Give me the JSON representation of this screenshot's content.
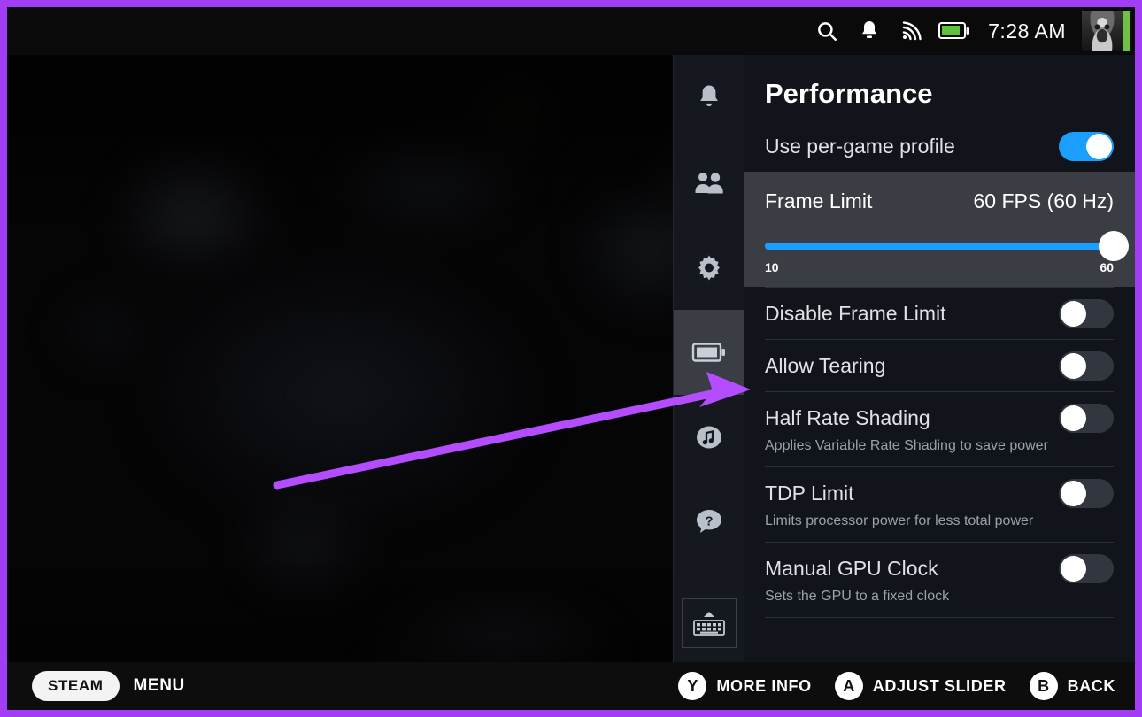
{
  "theme": {
    "border_accent": "#a23cf5",
    "panel_bg": "#11141b",
    "toggle_on": "#1a9fff",
    "slider_fill": "#1a9fff",
    "selected_row_bg": "#3a3d44",
    "status_online": "#6fc045"
  },
  "statusbar": {
    "icons": [
      "search-icon",
      "notifications-bell-icon",
      "wifi-icon",
      "battery-icon"
    ],
    "time": "7:28 AM",
    "avatar_name": "user-avatar"
  },
  "sidebar": {
    "items": [
      {
        "name": "notifications",
        "icon": "bell-icon",
        "active": false
      },
      {
        "name": "friends",
        "icon": "friends-icon",
        "active": false
      },
      {
        "name": "settings",
        "icon": "gear-icon",
        "active": false
      },
      {
        "name": "performance",
        "icon": "battery-icon",
        "active": true
      },
      {
        "name": "music",
        "icon": "music-note-icon",
        "active": false
      },
      {
        "name": "help",
        "icon": "question-mark-icon",
        "active": false
      }
    ],
    "keyboard_button": {
      "name": "on-screen-keyboard",
      "icon": "keyboard-icon"
    }
  },
  "panel": {
    "title": "Performance",
    "per_game_profile": {
      "label": "Use per-game profile",
      "state": "on"
    },
    "frame_limit": {
      "label": "Frame Limit",
      "value": "60 FPS (60 Hz)",
      "min_label": "10",
      "max_label": "60",
      "min": 10,
      "max": 60,
      "current": 60,
      "selected": true
    },
    "toggles": [
      {
        "label": "Disable Frame Limit",
        "desc": "",
        "state": "off"
      },
      {
        "label": "Allow Tearing",
        "desc": "",
        "state": "off"
      },
      {
        "label": "Half Rate Shading",
        "desc": "Applies Variable Rate Shading to save power",
        "state": "off"
      },
      {
        "label": "TDP Limit",
        "desc": "Limits processor power for less total power",
        "state": "off"
      },
      {
        "label": "Manual GPU Clock",
        "desc": "Sets the GPU to a fixed clock",
        "state": "off"
      }
    ]
  },
  "footer": {
    "steam_pill": "STEAM",
    "menu_label": "MENU",
    "hints": [
      {
        "key": "Y",
        "label": "MORE INFO"
      },
      {
        "key": "A",
        "label": "ADJUST SLIDER"
      },
      {
        "key": "B",
        "label": "BACK"
      }
    ]
  }
}
